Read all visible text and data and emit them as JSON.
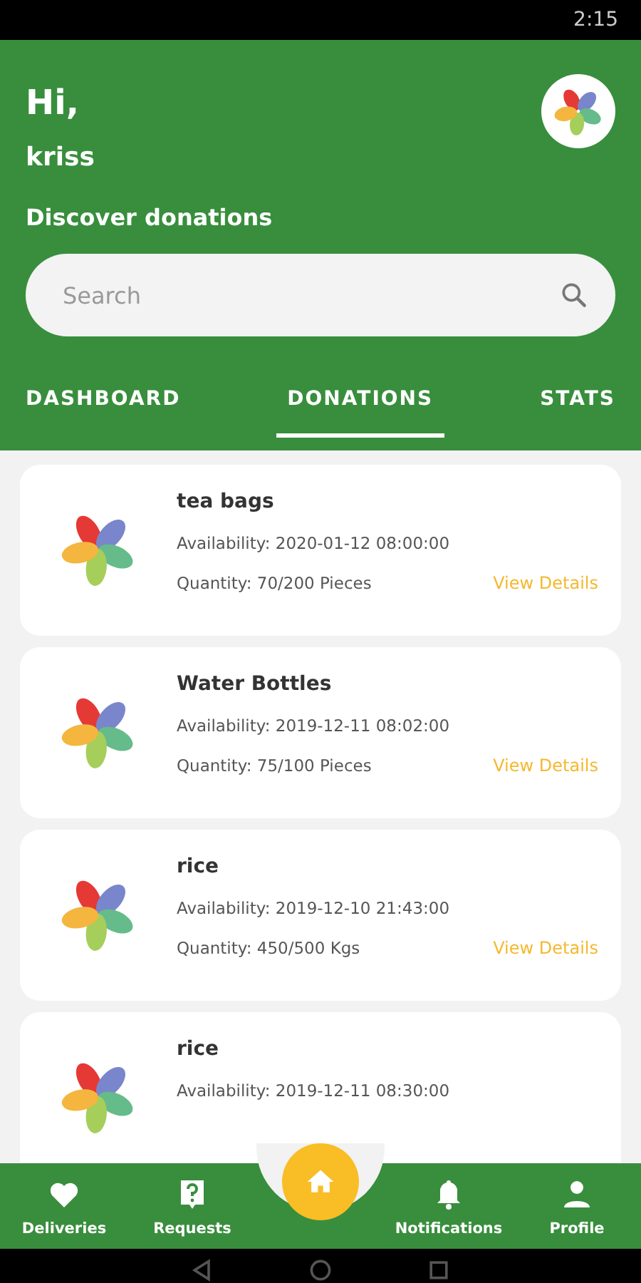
{
  "status_bar": {
    "time": "2:15"
  },
  "header": {
    "greeting": "Hi,",
    "user": "kriss",
    "subtitle": "Discover donations"
  },
  "search": {
    "placeholder": "Search"
  },
  "tabs": [
    {
      "label": "DASHBOARD",
      "selected": false
    },
    {
      "label": "DONATIONS",
      "selected": true
    },
    {
      "label": "STATS",
      "selected": false
    }
  ],
  "donations": [
    {
      "title": "tea bags",
      "availability": "Availability: 2020-01-12 08:00:00",
      "quantity": "Quantity: 70/200 Pieces",
      "action": "View Details"
    },
    {
      "title": "Water Bottles",
      "availability": "Availability: 2019-12-11 08:02:00",
      "quantity": "Quantity: 75/100 Pieces",
      "action": "View Details"
    },
    {
      "title": "rice",
      "availability": "Availability: 2019-12-10 21:43:00",
      "quantity": "Quantity: 450/500 Kgs",
      "action": "View Details"
    },
    {
      "title": "rice",
      "availability": "Availability: 2019-12-11 08:30:00"
    }
  ],
  "bottom_nav": [
    {
      "label": "Deliveries",
      "kind": "heart"
    },
    {
      "label": "Requests",
      "kind": "question"
    },
    {
      "label": "Notifications",
      "kind": "bell"
    },
    {
      "label": "Profile",
      "kind": "person"
    }
  ]
}
